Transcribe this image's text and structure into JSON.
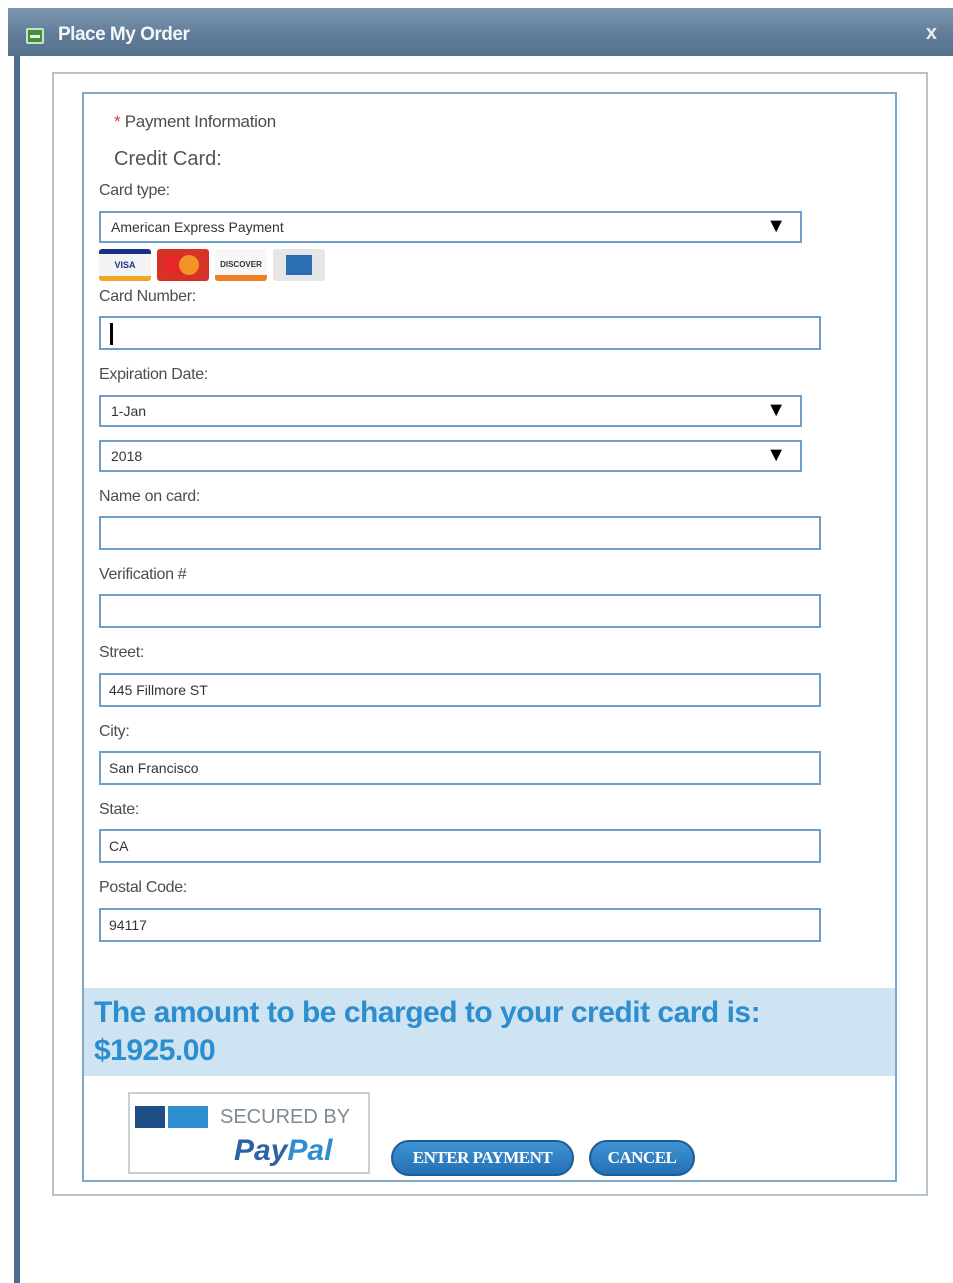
{
  "window": {
    "title": "Place My Order",
    "close_glyph": "x"
  },
  "payment": {
    "required_marker": "*",
    "header": "Payment Information",
    "section_title": "Credit Card:"
  },
  "fields": {
    "card_type": {
      "label": "Card type:",
      "value": "American Express Payment"
    },
    "card_logos": [
      {
        "name": "visa-icon",
        "text": "VISA"
      },
      {
        "name": "mastercard-icon",
        "text": ""
      },
      {
        "name": "discover-icon",
        "text": "DISCOVER"
      },
      {
        "name": "amex-icon",
        "text": ""
      }
    ],
    "card_number": {
      "label": "Card Number:",
      "value": ""
    },
    "expiration": {
      "label": "Expiration Date:",
      "month": "1-Jan",
      "year": "2018"
    },
    "name_on_card": {
      "label": "Name on card:",
      "value": ""
    },
    "verification": {
      "label": "Verification #",
      "value": ""
    },
    "street": {
      "label": "Street:",
      "value": "445 Fillmore ST"
    },
    "city": {
      "label": "City:",
      "value": "San Francisco"
    },
    "state": {
      "label": "State:",
      "value": "CA"
    },
    "postal_code": {
      "label": "Postal Code:",
      "value": "94117"
    }
  },
  "charge": {
    "message": "The amount to be charged to your credit card is:",
    "amount": "$1925.00"
  },
  "paypal": {
    "secured_text": "SECURED BY",
    "brand_pay": "Pay",
    "brand_pal": "Pal"
  },
  "buttons": {
    "enter_payment": "ENTER PAYMENT",
    "cancel": "CANCEL"
  },
  "colors": {
    "title_bar": "#5e7a96",
    "field_border": "#6f9fc8",
    "charge_banner_bg": "#cfe4f2",
    "charge_text": "#2d8ecf",
    "button_bg": "#2f80c2",
    "required_star": "#d83b3b"
  }
}
